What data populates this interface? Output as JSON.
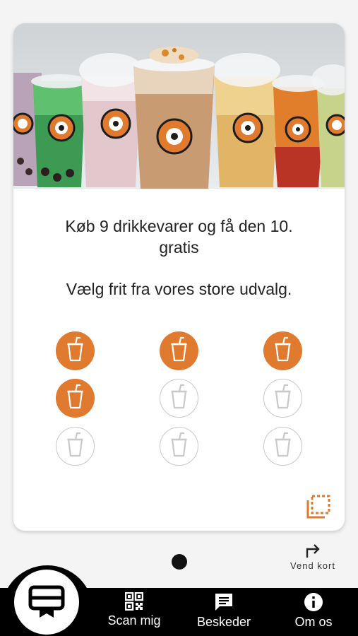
{
  "card": {
    "hero_image": "iced-drinks-photo",
    "promo_line": "Køb 9 drikkevarer og få den 10. gratis",
    "sub_line": "Vælg frit fra vores store udvalg.",
    "stamps": [
      true,
      true,
      true,
      true,
      false,
      false,
      false,
      false,
      false
    ],
    "stamps_collected": 4,
    "stamps_total": 9,
    "accent_color": "#e07a2e",
    "empty_color": "#c9c9c9",
    "flip_icon": "flip-corner-icon"
  },
  "controls": {
    "flip_label": "Vend kort",
    "flip_icon": "turn-arrow-icon"
  },
  "nav": {
    "card_icon": "loyalty-card-icon",
    "items": [
      {
        "label": "Scan mig",
        "icon": "qr-code-icon"
      },
      {
        "label": "Beskeder",
        "icon": "message-icon"
      },
      {
        "label": "Om os",
        "icon": "info-icon"
      }
    ]
  }
}
